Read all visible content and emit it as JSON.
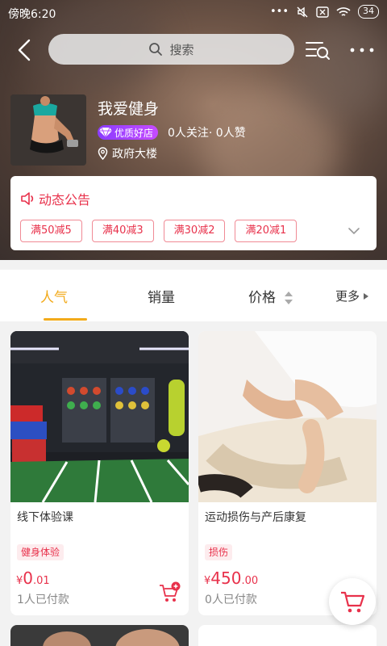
{
  "status": {
    "time": "傍晚6:20",
    "battery": "34"
  },
  "search": {
    "placeholder": "搜索"
  },
  "shop": {
    "name": "我爱健身",
    "badge": "优质好店",
    "followers": "0人关注· 0人赞",
    "location": "政府大楼"
  },
  "notice": {
    "title": "动态公告",
    "coupons": [
      "满50减5",
      "满40减3",
      "满30减2",
      "满20减1"
    ]
  },
  "tabs": {
    "popular": "人气",
    "sales": "销量",
    "price": "价格",
    "more": "更多"
  },
  "products": [
    {
      "title": "线下体验课",
      "tag": "健身体验",
      "currency": "¥",
      "price_int": "0",
      "price_dec": ".01",
      "sold": "1人已付款"
    },
    {
      "title": "运动损伤与产后康复",
      "tag": "损伤",
      "currency": "¥",
      "price_int": "450",
      "price_dec": ".00",
      "sold": "0人已付款"
    }
  ],
  "colors": {
    "accent": "#f2aa1a",
    "red": "#e8314b",
    "badge": "#a040ff"
  }
}
